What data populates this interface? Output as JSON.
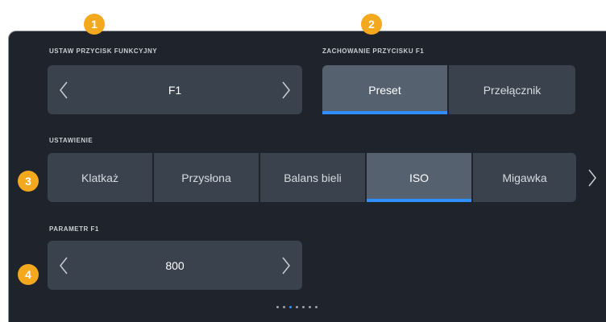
{
  "function_button": {
    "label": "USTAW PRZYCISK FUNKCYJNY",
    "value": "F1"
  },
  "button_behavior": {
    "label": "ZACHOWANIE PRZYCISKU F1",
    "options": [
      "Preset",
      "Przełącznik"
    ],
    "selected": "Preset"
  },
  "setting": {
    "label": "USTAWIENIE",
    "options": [
      "Klatkaż",
      "Przysłona",
      "Balans bieli",
      "ISO",
      "Migawka"
    ],
    "selected": "ISO"
  },
  "parameter": {
    "label": "PARAMETR F1",
    "value": "800"
  },
  "callouts": [
    "1",
    "2",
    "3",
    "4"
  ],
  "pagination": {
    "total": 7,
    "active_index": 2
  },
  "icons": {
    "prev": "chevron-left-icon",
    "next": "chevron-right-icon"
  },
  "colors": {
    "panel": "#1f242c",
    "button": "#3a424d",
    "selected_button": "#566170",
    "accent": "#2f8fff",
    "callout": "#f4a81d"
  }
}
